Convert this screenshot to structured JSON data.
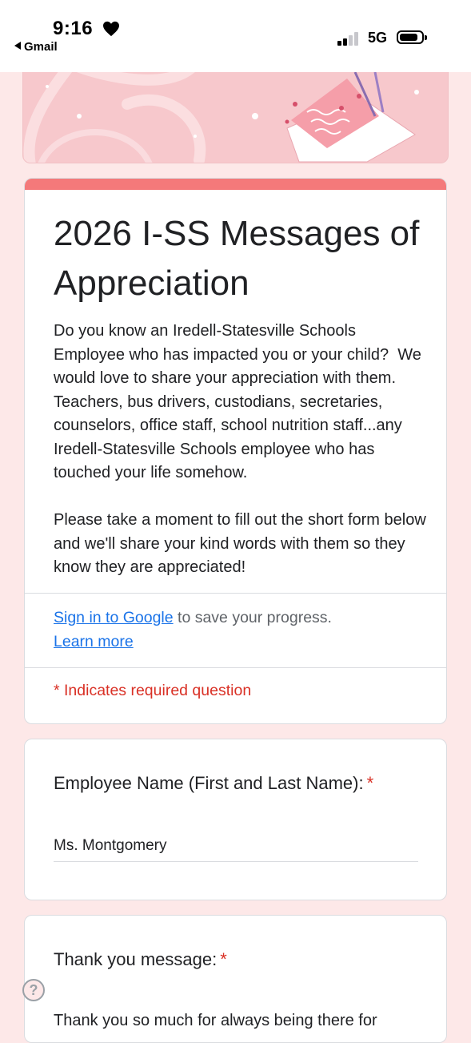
{
  "status_bar": {
    "time": "9:16",
    "back_app": "Gmail",
    "network": "5G"
  },
  "form": {
    "title": "2026 I-SS Messages of Appreciation",
    "description": "Do you know an Iredell-Statesville Schools Employee who has impacted you or your child?  We would love to share your appreciation with them.  Teachers, bus drivers, custodians, secretaries, counselors, office staff, school nutrition staff...any Iredell-Statesville Schools employee who has touched your life somehow.\n\nPlease take a moment to fill out the short form below and we'll share your kind words with them so they know they are appreciated!",
    "signin_link": "Sign in to Google",
    "signin_text": " to save your progress.",
    "learn_more": "Learn more",
    "required_note": "* Indicates required question",
    "accent_color": "#f4797a"
  },
  "questions": [
    {
      "label": "Employee Name (First and Last Name):",
      "required_mark": "*",
      "answer": "Ms. Montgomery"
    },
    {
      "label": "Thank you message:",
      "required_mark": "*",
      "answer": "Thank you so much for always being there for"
    }
  ],
  "help_icon": "?"
}
